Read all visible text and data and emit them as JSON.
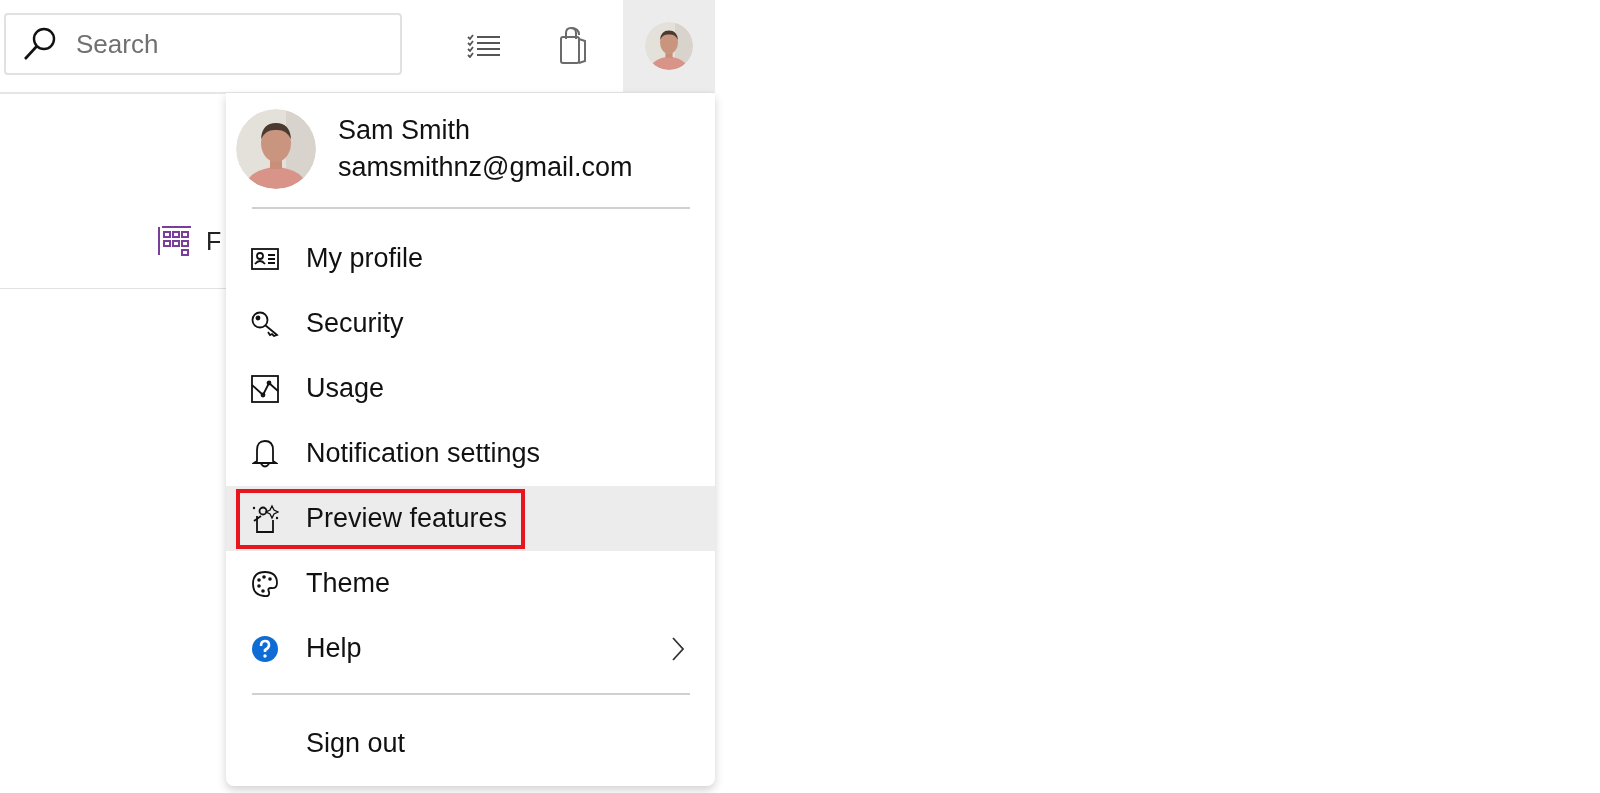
{
  "top_bar": {
    "search": {
      "placeholder": "Search"
    },
    "account_open": true
  },
  "background_tab": {
    "label": "F"
  },
  "account_menu": {
    "user": {
      "name": "Sam Smith",
      "email": "samsmithnz@gmail.com"
    },
    "items": [
      {
        "label": "My profile",
        "hovered": false,
        "annotated": false,
        "submenu": false
      },
      {
        "label": "Security",
        "hovered": false,
        "annotated": false,
        "submenu": false
      },
      {
        "label": "Usage",
        "hovered": false,
        "annotated": false,
        "submenu": false
      },
      {
        "label": "Notification settings",
        "hovered": false,
        "annotated": false,
        "submenu": false
      },
      {
        "label": "Preview features",
        "hovered": true,
        "annotated": true,
        "submenu": false
      },
      {
        "label": "Theme",
        "hovered": false,
        "annotated": false,
        "submenu": false
      },
      {
        "label": "Help",
        "hovered": false,
        "annotated": false,
        "submenu": true
      }
    ],
    "sign_out": {
      "label": "Sign out"
    }
  }
}
